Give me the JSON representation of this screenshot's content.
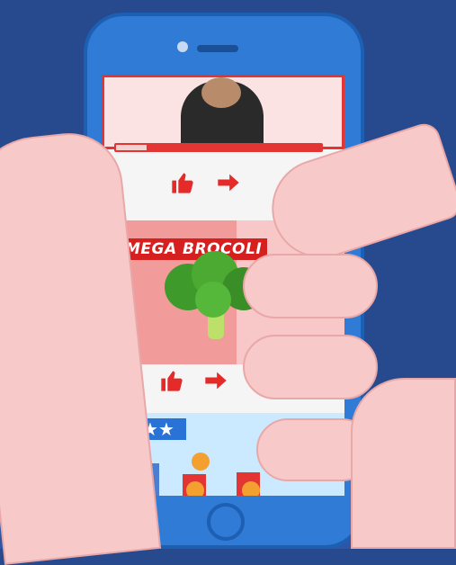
{
  "card2": {
    "title": "MEGA BROCOLI"
  },
  "progress": {
    "value": 0.15
  },
  "stars": {
    "text": "★★★"
  },
  "icons": [
    "heart-icon",
    "thumbs-up-icon",
    "share-arrow-icon"
  ],
  "colors": {
    "accent": "#e52a2a",
    "phone": "#2f7bd6",
    "background": "#274a8f"
  }
}
